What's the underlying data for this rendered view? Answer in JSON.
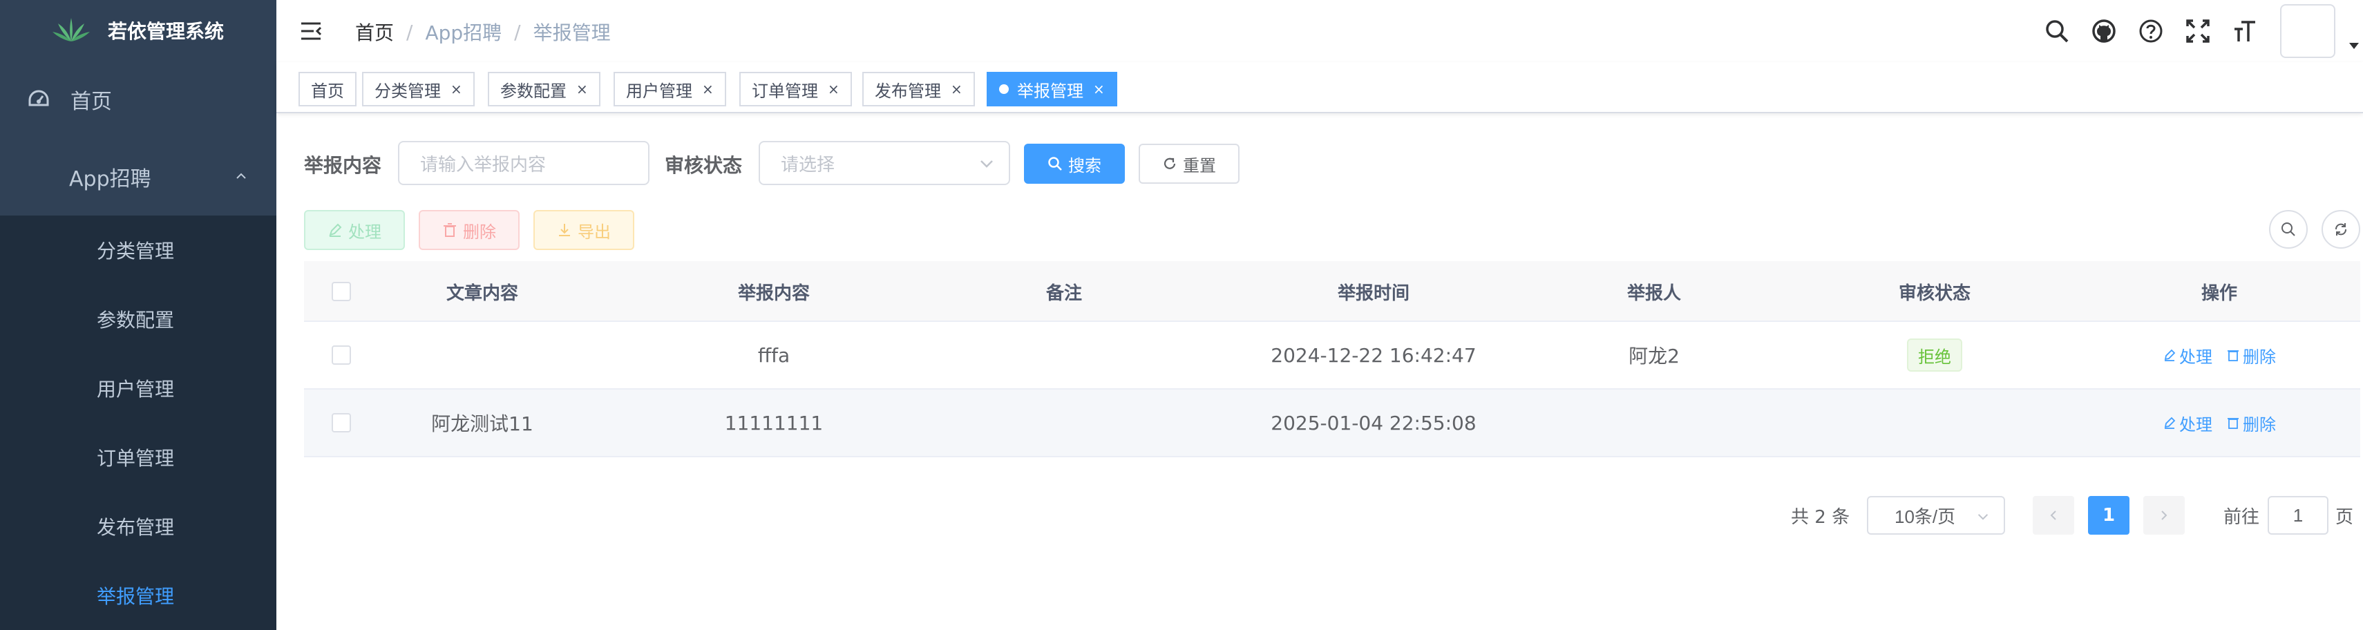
{
  "sidebar": {
    "logo_text": "若依管理系统",
    "home": "首页",
    "group": "App招聘",
    "items": [
      {
        "label": "分类管理"
      },
      {
        "label": "参数配置"
      },
      {
        "label": "用户管理"
      },
      {
        "label": "订单管理"
      },
      {
        "label": "发布管理"
      },
      {
        "label": "举报管理",
        "active": true
      }
    ]
  },
  "navbar": {
    "breadcrumb": [
      "首页",
      "App招聘",
      "举报管理"
    ],
    "separator": "/",
    "icons": [
      "search-icon",
      "github-icon",
      "question-icon",
      "fullscreen-icon",
      "font-size-icon",
      "avatar",
      "caret-down-icon"
    ]
  },
  "tags": [
    {
      "label": "首页",
      "closable": false
    },
    {
      "label": "分类管理",
      "closable": true
    },
    {
      "label": "参数配置",
      "closable": true
    },
    {
      "label": "用户管理",
      "closable": true
    },
    {
      "label": "订单管理",
      "closable": true
    },
    {
      "label": "发布管理",
      "closable": true
    },
    {
      "label": "举报管理",
      "closable": true,
      "active": true
    }
  ],
  "close_glyph": "×",
  "search": {
    "content_label": "举报内容",
    "content_placeholder": "请输入举报内容",
    "status_label": "审核状态",
    "status_placeholder": "请选择",
    "search_btn": "搜索",
    "reset_btn": "重置"
  },
  "toolbar": {
    "handle": "处理",
    "delete": "删除",
    "export": "导出"
  },
  "table": {
    "columns": [
      "文章内容",
      "举报内容",
      "备注",
      "举报时间",
      "举报人",
      "审核状态",
      "操作"
    ],
    "rows": [
      {
        "article": "",
        "content": "fffa",
        "remark": "",
        "time": "2024-12-22 16:42:47",
        "reporter": "阿龙2",
        "status": "拒绝"
      },
      {
        "article": "阿龙测试11",
        "content": "11111111",
        "remark": "",
        "time": "2025-01-04 22:55:08",
        "reporter": "",
        "status": ""
      }
    ],
    "actions": {
      "handle": "处理",
      "delete": "删除"
    }
  },
  "pagination": {
    "total": "共 2 条",
    "page_size": "10条/页",
    "current": "1",
    "goto_label": "前往",
    "goto_value": "1",
    "page_suffix": "页"
  },
  "colors": {
    "sidebar_bg": "#304156",
    "submenu_bg": "#1f2d3d",
    "primary": "#409eff",
    "success": "#67c23a"
  }
}
